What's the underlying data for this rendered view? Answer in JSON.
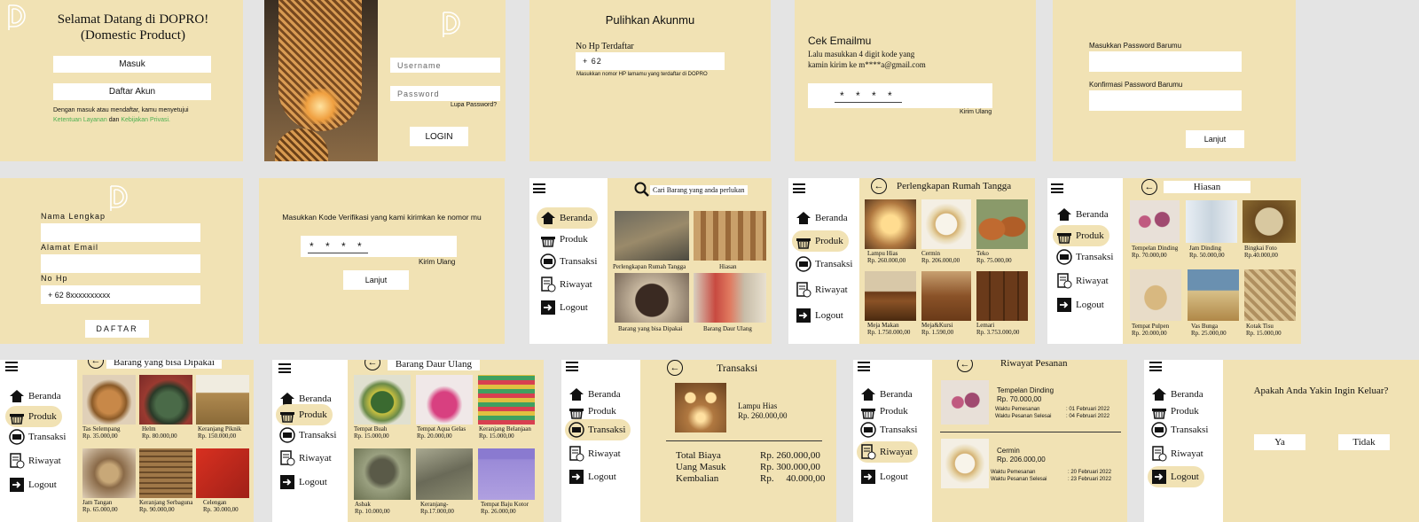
{
  "s1": {
    "title1": "Selamat Datang di DOPRO!",
    "title2": "(Domestic Product)",
    "masuk": "Masuk",
    "daftar": "Daftar Akun",
    "terms_pre": "Dengan masuk atau mendaftar, kamu menyetujui",
    "terms_link1": "Ketentuan Layanan",
    "terms_mid": "dan",
    "terms_link2": "Kebijakan Privasi."
  },
  "s2": {
    "username_ph": "Username",
    "password_ph": "Password",
    "lupa": "Lupa Password?",
    "login": "LOGIN"
  },
  "s3": {
    "title": "Pulihkan Akunmu",
    "label": "No Hp Terdaftar",
    "value": "+ 62",
    "hint": "Masukkan nomor HP lamamu yang terdaftar di DOPRO"
  },
  "s4": {
    "title": "Cek Emailmu",
    "line1": "Lalu masukkan 4 digit kode yang",
    "line2": "kamin kirim ke m****a@gmail.com",
    "code": "* * * *",
    "resend": "Kirim Ulang"
  },
  "s5": {
    "label1": "Masukkan Password Barumu",
    "label2": "Konfirmasi Password Barumu",
    "button": "Lanjut"
  },
  "s6": {
    "nama": "Nama Lengkap",
    "email": "Alamat Email",
    "hp": "No Hp",
    "hp_value": "+ 62  8xxxxxxxxxx",
    "button": "DAFTAR"
  },
  "s7": {
    "text": "Masukkan Kode Verifikasi yang kami kirimkan ke nomor mu",
    "code": "* * * *",
    "resend": "Kirim Ulang",
    "button": "Lanjut"
  },
  "nav": {
    "beranda": "Beranda",
    "produk": "Produk",
    "transaksi": "Transaksi",
    "riwayat": "Riwayat",
    "logout": "Logout"
  },
  "s8": {
    "search": "Cari Barang yang anda perlukan",
    "cat1": "Perlengkapan Rumah Tangga",
    "cat2": "Hiasan",
    "cat3": "Barang yang bisa Dipakai",
    "cat4": "Barang Daur Ulang"
  },
  "s9": {
    "title": "Perlengkapan Rumah Tangga",
    "items": [
      {
        "name": "Lampu Hias",
        "price": "Rp. 260.000,00"
      },
      {
        "name": "Cermin",
        "price": "Rp. 206.000,00"
      },
      {
        "name": "Teko",
        "price": "Rp. 75.000,00"
      },
      {
        "name": "Meja Makan",
        "price": "Rp. 1.750.000,00"
      },
      {
        "name": "Meja&Kursi",
        "price": "Rp. 1.590,00"
      },
      {
        "name": "Lemari",
        "price": "Rp. 3.753.000,00"
      }
    ]
  },
  "s10": {
    "title": "Hiasan",
    "items": [
      {
        "name": "Tempelan Dinding",
        "price": "Rp. 70.000,00"
      },
      {
        "name": "Jam Dinding",
        "price": "Rp. 50.000,00"
      },
      {
        "name": "Bingkai Foto",
        "price": "Rp.40.000,00"
      },
      {
        "name": "Tempat Pulpen",
        "price": "Rp. 20.000,00"
      },
      {
        "name": "Vas Bunga",
        "price": "Rp. 25.000,00"
      },
      {
        "name": "Kotak Tisu",
        "price": "Rp. 15.000,00"
      }
    ]
  },
  "s11": {
    "title": "Barang yang bisa Dipakai",
    "items": [
      {
        "name": "Tas Selempang",
        "price": "Rp. 35.000,00"
      },
      {
        "name": "Helm",
        "price": "Rp. 80.000,00"
      },
      {
        "name": "Keranjang Piknik",
        "price": "Rp. 150.000,00"
      },
      {
        "name": "Jam Tangan",
        "price": "Rp. 65.000,00"
      },
      {
        "name": "Keranjang Serbaguna",
        "price": "Rp. 90.000,00"
      },
      {
        "name": "Celengan",
        "price": "Rp. 30.000,00"
      }
    ]
  },
  "s12": {
    "title": "Barang Daur Ulang",
    "items": [
      {
        "name": "Tempat Buah",
        "price": "Rp. 15.000,00"
      },
      {
        "name": "Tempat Aqua Gelas",
        "price": "Rp. 20.000,00"
      },
      {
        "name": "Keranjang Belanjaan",
        "price": "Rp. 15.000,00"
      },
      {
        "name": "Asbak",
        "price": "Rp. 10.000,00"
      },
      {
        "name": "Keranjang-",
        "price": "Rp.17.000,00"
      },
      {
        "name": "Tempat Baju Kotor",
        "price": "Rp. 26.000,00"
      }
    ]
  },
  "s13": {
    "title": "Transaksi",
    "item_name": "Lampu Hias",
    "item_price": "Rp. 260.000,00",
    "total_label": "Total Biaya",
    "total_value": "Rp. 260.000,00",
    "uang_label": "Uang Masuk",
    "uang_value": "Rp. 300.000,00",
    "kembali_label": "Kembalian",
    "kembali_value": "Rp.     40.000,00"
  },
  "s14": {
    "title": "Riwayat Pesanan",
    "orders": [
      {
        "name": "Tempelan Dinding",
        "price": "Rp. 70.000,00",
        "t1_label": "Waktu Pemesanan",
        "t1": ": 01 Februari 2022",
        "t2_label": "Waktu Pesanan Selesai",
        "t2": ": 04 Februari 2022"
      },
      {
        "name": "Cermin",
        "price": "Rp. 206.000,00",
        "t1_label": "Waktu Pemesanan",
        "t1": ": 20 Februari 2022",
        "t2_label": "Waktu Pesanan Selesai",
        "t2": ": 23 Februari 2022"
      }
    ]
  },
  "s15": {
    "question": "Apakah Anda Yakin Ingin Keluar?",
    "yes": "Ya",
    "no": "Tidak"
  },
  "colors": {
    "bg": "#e4e4e4",
    "panel": "#f1e2b4",
    "link": "#4caf50"
  }
}
